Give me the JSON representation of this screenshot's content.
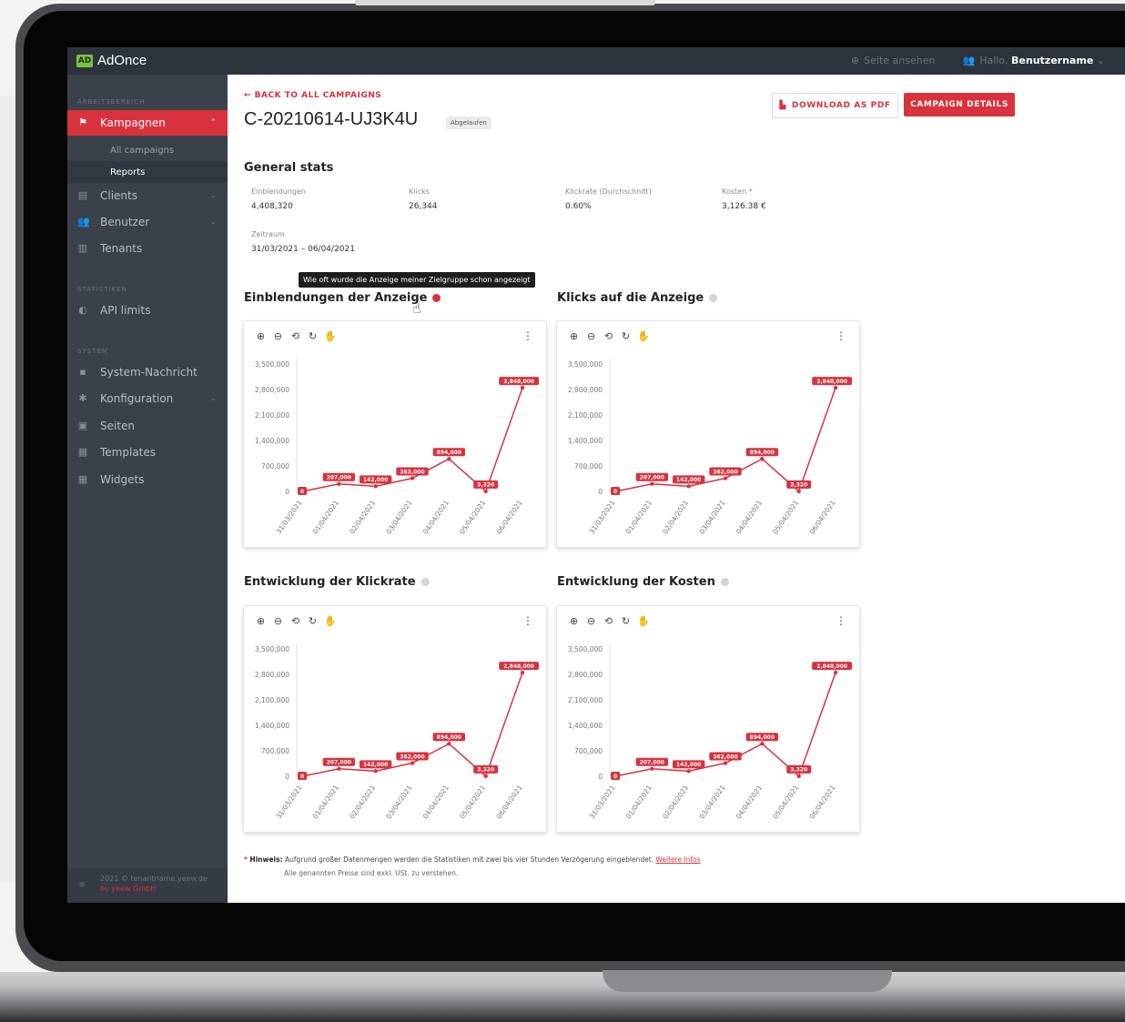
{
  "app": {
    "logo_mark": "AD",
    "name": "AdOnce"
  },
  "topbar": {
    "view_site": "Seite ansehen",
    "greeting": "Hallo,",
    "username": "Benutzername"
  },
  "sidebar": {
    "section_workspace": "ARBEITSBEREICH",
    "section_stats": "STATISTIKEN",
    "section_system": "SYSTEM",
    "items": {
      "campaigns": "Kampagnen",
      "all_campaigns": "All campaigns",
      "reports": "Reports",
      "clients": "Clients",
      "users": "Benutzer",
      "tenants": "Tenants",
      "api_limits": "API limits",
      "system_message": "System-Nachricht",
      "configuration": "Konfiguration",
      "pages": "Seiten",
      "templates": "Templates",
      "widgets": "Widgets"
    },
    "footer_line1": "2021 © tenantname.yeew.de",
    "footer_line2": "by yeew GmbH"
  },
  "header": {
    "back": "← BACK TO ALL CAMPAIGNS",
    "campaign_id": "C-20210614-UJ3K4U",
    "status": "Abgelaufen",
    "download_pdf": "DOWNLOAD AS PDF",
    "campaign_details": "CAMPAIGN DETAILS"
  },
  "stats": {
    "heading": "General stats",
    "impressions_label": "Einblendungen",
    "impressions_value": "4,408,320",
    "clicks_label": "Klicks",
    "clicks_value": "26,344",
    "ctr_label": "Klickrate (Durchschnitt)",
    "ctr_value": "0.60%",
    "cost_label": "Kosten *",
    "cost_value": "3,126.38 €",
    "period_label": "Zeitraum",
    "period_value": "31/03/2021 – 06/04/2021"
  },
  "tooltip": "Wie oft wurde die Anzeige meiner Zielgruppe schon angezeigt",
  "chart_titles": {
    "impressions": "Einblendungen der Anzeige",
    "clicks": "Klicks auf die Anzeige",
    "ctr": "Entwicklung der Klickrate",
    "cost": "Entwicklung der Kosten"
  },
  "colors": {
    "accent": "#d8323f",
    "sidebar": "#3a414b",
    "topbar": "#2d333b"
  },
  "toolbar_icons": [
    "zoom-in-icon",
    "zoom-out-icon",
    "zoom-reset-icon",
    "refresh-icon",
    "pan-hand-icon"
  ],
  "chart_data": [
    {
      "type": "line",
      "x": [
        "31/03/2021",
        "01/04/2021",
        "02/04/2021",
        "03/04/2021",
        "04/04/2021",
        "05/04/2021",
        "06/04/2021"
      ],
      "y": [
        0,
        207000,
        142000,
        363000,
        894000,
        3320,
        2848000
      ],
      "data_labels": [
        "0",
        "207,000",
        "142,000",
        "363,000",
        "894,000",
        "3,320",
        "2,848,000"
      ],
      "y_ticks": [
        "3,500,000",
        "2,800,000",
        "2,100,000",
        "1,400,000",
        "700,000",
        "0"
      ],
      "ylim": [
        0,
        3500000
      ],
      "grid": false
    },
    {
      "type": "line",
      "x": [
        "31/03/2021",
        "01/04/2021",
        "02/04/2021",
        "03/04/2021",
        "04/04/2021",
        "05/04/2021",
        "06/04/2021"
      ],
      "y": [
        0,
        207000,
        142000,
        362000,
        894000,
        3320,
        2848000
      ],
      "data_labels": [
        "0",
        "207,000",
        "142,000",
        "362,000",
        "894,000",
        "3,320",
        "2,848,000"
      ],
      "y_ticks": [
        "3,500,000",
        "2,800,000",
        "2,100,000",
        "1,400,000",
        "700,000",
        "0"
      ],
      "ylim": [
        0,
        3500000
      ],
      "grid": false
    },
    {
      "type": "line",
      "x": [
        "31/03/2021",
        "01/04/2021",
        "02/04/2021",
        "03/04/2021",
        "04/04/2021",
        "05/04/2021",
        "06/04/2021"
      ],
      "y": [
        0,
        207000,
        142000,
        362000,
        894000,
        3320,
        2848000
      ],
      "data_labels": [
        "0",
        "207,000",
        "142,000",
        "362,000",
        "894,000",
        "3,320",
        "2,848,000"
      ],
      "y_ticks": [
        "3,500,000",
        "2,800,000",
        "2,100,000",
        "1,400,000",
        "700,000",
        "0"
      ],
      "ylim": [
        0,
        3500000
      ],
      "grid": false
    },
    {
      "type": "line",
      "x": [
        "31/03/2021",
        "01/04/2021",
        "02/04/2021",
        "03/04/2021",
        "04/04/2021",
        "05/04/2021",
        "06/04/2021"
      ],
      "y": [
        0,
        207000,
        142000,
        362000,
        894000,
        3320,
        2848000
      ],
      "data_labels": [
        "0",
        "207,000",
        "142,000",
        "362,000",
        "894,000",
        "3,320",
        "2,848,000"
      ],
      "y_ticks": [
        "3,500,000",
        "2,800,000",
        "2,100,000",
        "1,400,000",
        "700,000",
        "0"
      ],
      "ylim": [
        0,
        3500000
      ],
      "grid": false
    }
  ],
  "footer": {
    "note_label": "Hinweis:",
    "note_text": "Aufgrund großer Datenmengen werden die Statistiken mit zwei bis vier Stunden Verzögerung eingeblendet.",
    "note_link": "Weitere Infos",
    "note_line2": "Alle genannten Preise sind exkl. USt. zu verstehen."
  }
}
